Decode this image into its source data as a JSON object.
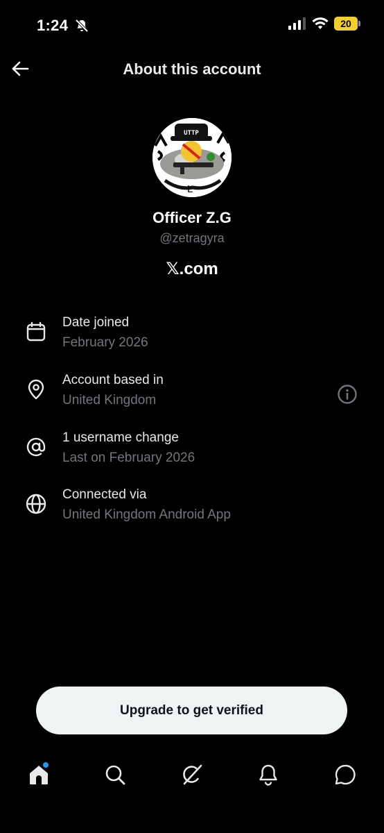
{
  "status_bar": {
    "time": "1:24",
    "battery": "20"
  },
  "header": {
    "title": "About this account"
  },
  "profile": {
    "avatar_text": "UTTP",
    "avatar_letter": "L",
    "display_name": "Officer Z.G",
    "handle": "@zetragyra",
    "site": "𝕏.com"
  },
  "info": [
    {
      "title": "Date joined",
      "subtitle": "February 2026",
      "icon": "calendar-icon"
    },
    {
      "title": "Account based in",
      "subtitle": "United Kingdom",
      "icon": "location-pin-icon",
      "has_info": true
    },
    {
      "title": "1 username change",
      "subtitle": "Last on February 2026",
      "icon": "at-sign-icon"
    },
    {
      "title": "Connected via",
      "subtitle": "United Kingdom Android App",
      "icon": "globe-icon"
    }
  ],
  "cta": {
    "label": "Upgrade to get verified"
  },
  "nav": {
    "items": [
      "home-icon",
      "search-icon",
      "grok-icon",
      "notifications-icon",
      "messages-icon"
    ],
    "accent": "#1d9bf0"
  }
}
